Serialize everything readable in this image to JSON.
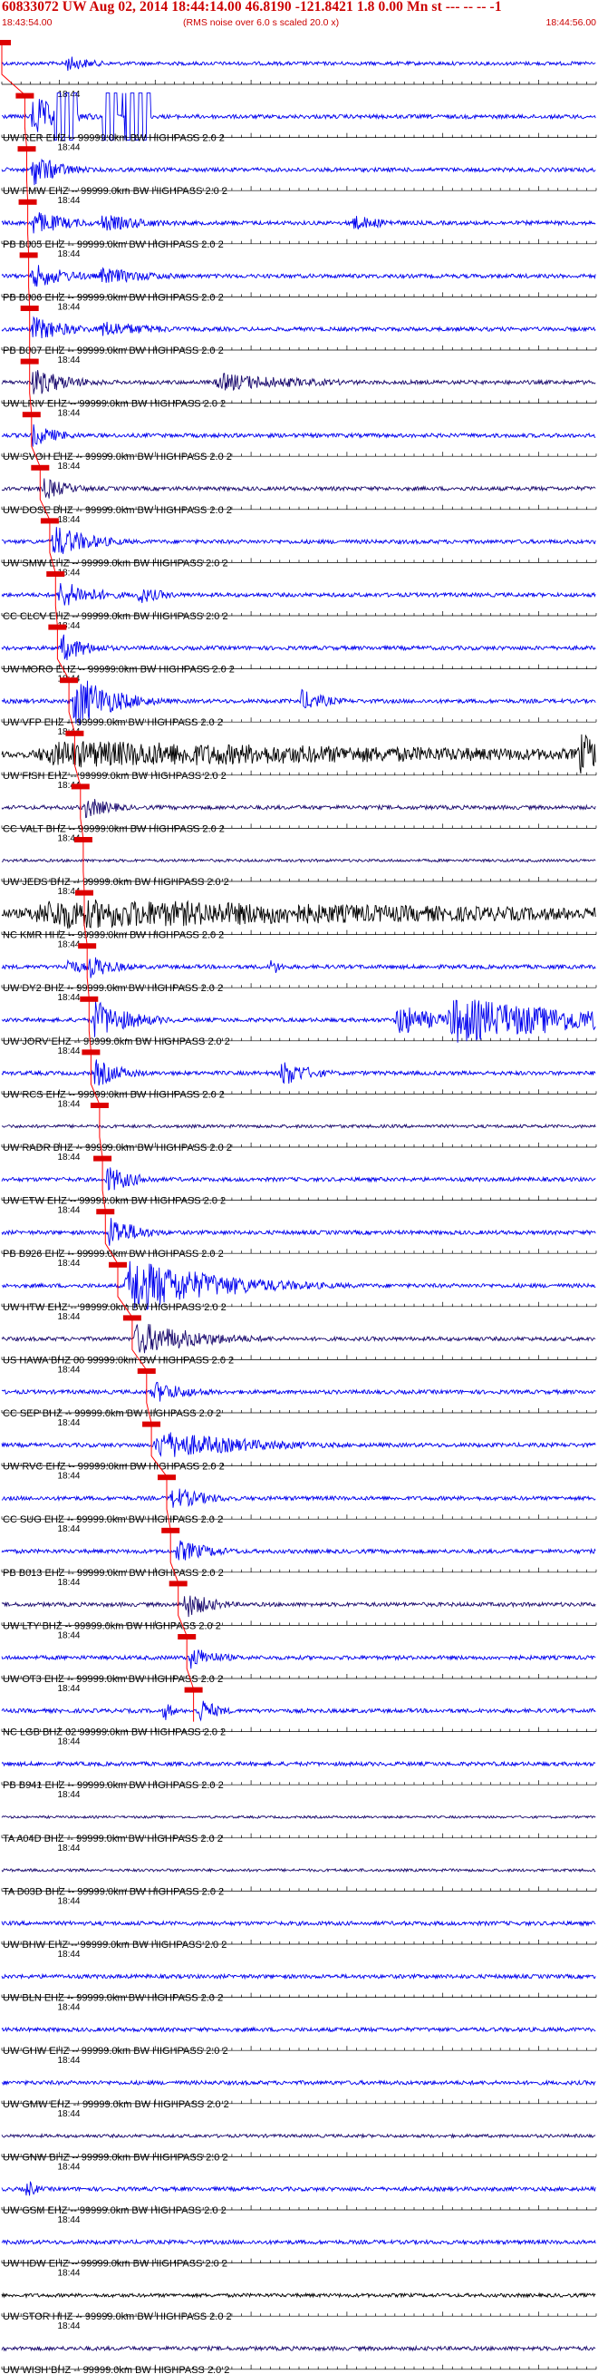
{
  "header": {
    "title": "60833072 UW Aug 02, 2014 18:44:14.00   46.8190 -121.8421  1.8 0.00 Mn st --- -- --  -1",
    "start_time": "18:43:54.00",
    "note": "(RMS noise over 6.0 s scaled 20.0 x)",
    "end_time": "18:44:56.00"
  },
  "colors": {
    "header_text": "#cc0000",
    "trace_blue": "#0000ee",
    "trace_navy": "#1a0a6e",
    "trace_black": "#000000",
    "pick_line": "#ff0000",
    "pick_box": "#dd0000",
    "label_text": "#000000",
    "tick": "#000000"
  },
  "chart_data": {
    "type": "seismogram",
    "time_start": "18:43:54.00",
    "time_end": "18:44:56.00",
    "tick_label": "18:44",
    "first_trace_name": "",
    "traces": [
      {
        "name": "",
        "color": "blue",
        "p_arrival_s": 0,
        "amp": 0.9,
        "bursts": [
          [
            6.5,
            3,
            1.6
          ]
        ]
      },
      {
        "name": "UW RER EHZ -- 99999.0km BW  HIGHPASS  2.0  2",
        "color": "blue",
        "p_arrival_s": 2.4,
        "amp": 1.0,
        "bursts": [
          [
            3,
            3,
            4
          ]
        ],
        "saturated": [
          [
            5.5,
            2.4
          ],
          [
            10.5,
            1.5
          ],
          [
            13,
            2.5
          ]
        ],
        "spikes": [
          11.8,
          12.6,
          12.9,
          13.8,
          14.2
        ]
      },
      {
        "name": "UW FMW EHZ -- 99999.0km BW  HIGHPASS  2.0  2",
        "color": "blue",
        "p_arrival_s": 2.6,
        "amp": 1.0,
        "bursts": [
          [
            3,
            3,
            3
          ]
        ]
      },
      {
        "name": "PB B005 EHZ -- 99999.0km BW  HIGHPASS  2.0  2",
        "color": "blue",
        "p_arrival_s": 2.7,
        "amp": 1.0,
        "bursts": [
          [
            3,
            4,
            2.2
          ],
          [
            10,
            6,
            1.5
          ],
          [
            36,
            4,
            1.5
          ]
        ]
      },
      {
        "name": "PB B006 EHZ -- 99999.0km BW  HIGHPASS  2.0  2",
        "color": "blue",
        "p_arrival_s": 2.8,
        "amp": 1.0,
        "bursts": [
          [
            3,
            4,
            2.2
          ],
          [
            10,
            6,
            1.5
          ]
        ]
      },
      {
        "name": "PB B007 EHZ -- 99999.0km BW  HIGHPASS  2.0  2",
        "color": "blue",
        "p_arrival_s": 2.9,
        "amp": 1.0,
        "bursts": [
          [
            3,
            4,
            2.2
          ],
          [
            10,
            6,
            1.5
          ]
        ]
      },
      {
        "name": "UW LRIV EHZ -- 99999.0km BW  HIGHPASS  2.0  2",
        "color": "navy",
        "p_arrival_s": 2.9,
        "amp": 1.0,
        "bursts": [
          [
            3,
            4,
            2.5
          ],
          [
            22,
            10,
            1.6
          ]
        ]
      },
      {
        "name": "UW SVOH EHZ -- 99999.0km BW  HIGHPASS  2.0  2",
        "color": "blue",
        "p_arrival_s": 3.1,
        "amp": 1.0,
        "bursts": [
          [
            3,
            3,
            2
          ]
        ]
      },
      {
        "name": "UW DOSE BHZ -- 99999.0km BW  HIGHPASS  2.0  2",
        "color": "navy",
        "p_arrival_s": 4.0,
        "amp": 1.0,
        "bursts": [
          [
            4.2,
            3,
            2
          ]
        ]
      },
      {
        "name": "UW SMW EHZ -- 99999.0km BW  HIGHPASS  2.0  2",
        "color": "blue",
        "p_arrival_s": 5.0,
        "amp": 1.0,
        "bursts": [
          [
            5.1,
            4,
            3
          ]
        ]
      },
      {
        "name": "CC CLCV EHZ -- 99999.0km BW  HIGHPASS  2.0  2",
        "color": "blue",
        "p_arrival_s": 5.6,
        "amp": 1.0,
        "bursts": [
          [
            5.8,
            4,
            2.5
          ],
          [
            14,
            3,
            1.6
          ]
        ]
      },
      {
        "name": "UW MORO EHZ -- 99999.0km BW  HIGHPASS  2.0  2",
        "color": "blue",
        "p_arrival_s": 5.8,
        "amp": 1.0,
        "bursts": [
          [
            6,
            3,
            2.5
          ]
        ]
      },
      {
        "name": "UW VFP EHZ -- 99999.0km BW  HIGHPASS  2.0  2",
        "color": "blue",
        "p_arrival_s": 7.0,
        "amp": 1.0,
        "bursts": [
          [
            7.3,
            4,
            5
          ],
          [
            31,
            3,
            2
          ]
        ]
      },
      {
        "name": "UW FISH EHZ -- 99999.0km BW  HIGHPASS  2.0  2",
        "color": "black",
        "p_arrival_s": 7.6,
        "amp": 1.6,
        "bursts": [
          [
            2,
            55,
            1.5
          ],
          [
            60,
            3,
            2.5
          ]
        ]
      },
      {
        "name": "CC VALT BHZ -- 99999.0km BW  HIGHPASS  2.0  2",
        "color": "navy",
        "p_arrival_s": 8.2,
        "amp": 1.0,
        "bursts": [
          [
            8.5,
            3,
            2
          ]
        ]
      },
      {
        "name": "UW JEDS BHZ -- 99999.0km BW  HIGHPASS  2.0  2",
        "color": "navy",
        "p_arrival_s": 8.5,
        "amp": 0.7,
        "bursts": []
      },
      {
        "name": "NC KMR HHZ -- 99999.0km BW  HIGHPASS  2.0  2",
        "color": "black",
        "p_arrival_s": 8.6,
        "amp": 2.2,
        "bursts": [
          [
            1,
            58,
            1.2
          ]
        ]
      },
      {
        "name": "UW DY2 BHZ -- 99999.0km BW  HIGHPASS  2.0  2",
        "color": "blue",
        "p_arrival_s": 8.9,
        "amp": 1.0,
        "bursts": [
          [
            9,
            3,
            2
          ],
          [
            6.5,
            2,
            1.8
          ],
          [
            28,
            1,
            1.8
          ]
        ]
      },
      {
        "name": "UW JORV EHZ -- 99999.0km BW  HIGHPASS  2.0  2",
        "color": "blue",
        "p_arrival_s": 9.1,
        "amp": 1.0,
        "bursts": [
          [
            9.3,
            4,
            3.5
          ],
          [
            41,
            4,
            3
          ],
          [
            46,
            16,
            4
          ]
        ]
      },
      {
        "name": "UW RCS EHZ -- 99999.0km BW  HIGHPASS  2.0  2",
        "color": "blue",
        "p_arrival_s": 9.3,
        "amp": 1.0,
        "bursts": [
          [
            9.5,
            3,
            2.5
          ],
          [
            29,
            3,
            2.5
          ]
        ]
      },
      {
        "name": "UW RADR BHZ -- 99999.0km BW  HIGHPASS  2.0  2",
        "color": "navy",
        "p_arrival_s": 10.2,
        "amp": 0.8,
        "bursts": []
      },
      {
        "name": "UW ETW EHZ -- 99999.0km BW  HIGHPASS  2.0  2",
        "color": "blue",
        "p_arrival_s": 10.5,
        "amp": 1.0,
        "bursts": [
          [
            10.8,
            3,
            2.5
          ]
        ]
      },
      {
        "name": "PB B926 EHZ -- 99999.0km BW  HIGHPASS  2.0  2",
        "color": "blue",
        "p_arrival_s": 10.8,
        "amp": 1.0,
        "bursts": [
          [
            11,
            3,
            3
          ]
        ]
      },
      {
        "name": "UW HTW EHZ -- 99999.0km BW  HIGHPASS  2.0  2",
        "color": "blue",
        "p_arrival_s": 12.1,
        "amp": 1.0,
        "bursts": [
          [
            12.7,
            9,
            5
          ]
        ]
      },
      {
        "name": "US HAWA BHZ 00 99999.0km BW  HIGHPASS  2.0  2",
        "color": "navy",
        "p_arrival_s": 13.6,
        "amp": 1.0,
        "bursts": [
          [
            13.6,
            7,
            3
          ]
        ]
      },
      {
        "name": "CC SEP BHZ -- 99999.0km BW  HIGHPASS  2.0  2",
        "color": "blue",
        "p_arrival_s": 15.1,
        "amp": 1.0,
        "bursts": [
          [
            15.5,
            4,
            2
          ]
        ]
      },
      {
        "name": "UW RVC EHZ -- 99999.0km BW  HIGHPASS  2.0  2",
        "color": "blue",
        "p_arrival_s": 15.6,
        "amp": 1.0,
        "bursts": [
          [
            15.7,
            10,
            2.5
          ],
          [
            19,
            5,
            2
          ]
        ]
      },
      {
        "name": "CC SUG EHZ -- 99999.0km BW  HIGHPASS  2.0  2",
        "color": "blue",
        "p_arrival_s": 17.2,
        "amp": 1.0,
        "bursts": [
          [
            17.5,
            4,
            2
          ]
        ]
      },
      {
        "name": "PB B013 EHZ -- 99999.0km BW  HIGHPASS  2.0  2",
        "color": "blue",
        "p_arrival_s": 17.6,
        "amp": 1.0,
        "bursts": [
          [
            18,
            4,
            2
          ]
        ]
      },
      {
        "name": "UW LTY BHZ -- 99999.0km BW  HIGHPASS  2.0  2",
        "color": "navy",
        "p_arrival_s": 18.4,
        "amp": 1.0,
        "bursts": [
          [
            18.8,
            3,
            2.5
          ]
        ]
      },
      {
        "name": "UW OT3 EHZ -- 99999.0km BW  HIGHPASS  2.0  2",
        "color": "blue",
        "p_arrival_s": 19.3,
        "amp": 1.0,
        "bursts": [
          [
            19.5,
            3,
            2
          ]
        ]
      },
      {
        "name": "NC LGB BHZ 02 99999.0km BW  HIGHPASS  2.0  2",
        "color": "blue",
        "p_arrival_s": 20.0,
        "amp": 1.0,
        "bursts": [
          [
            20.3,
            2,
            2.5
          ],
          [
            16.8,
            1,
            2
          ]
        ]
      },
      {
        "name": "PB B941 EHZ -- 99999.0km BW  HIGHPASS  2.0  2",
        "color": "blue",
        "p_arrival_s": null,
        "amp": 1.0,
        "bursts": []
      },
      {
        "name": "TA A04D BHZ -- 99999.0km BW  HIGHPASS  2.0  2",
        "color": "navy",
        "p_arrival_s": null,
        "amp": 0.6,
        "bursts": []
      },
      {
        "name": "TA D03D BHZ -- 99999.0km BW  HIGHPASS  2.0  2",
        "color": "navy",
        "p_arrival_s": null,
        "amp": 0.7,
        "bursts": []
      },
      {
        "name": "UW BHW EHZ -- 99999.0km BW  HIGHPASS  2.0  2",
        "color": "blue",
        "p_arrival_s": null,
        "amp": 1.0,
        "bursts": []
      },
      {
        "name": "UW BLN EHZ -- 99999.0km BW  HIGHPASS  2.0  2",
        "color": "blue",
        "p_arrival_s": null,
        "amp": 1.0,
        "bursts": []
      },
      {
        "name": "UW GHW EHZ -- 99999.0km BW  HIGHPASS  2.0  2",
        "color": "blue",
        "p_arrival_s": null,
        "amp": 1.0,
        "bursts": []
      },
      {
        "name": "UW GMW EHZ -- 99999.0km BW  HIGHPASS  2.0  2",
        "color": "blue",
        "p_arrival_s": null,
        "amp": 1.0,
        "bursts": []
      },
      {
        "name": "UW GNW BHZ -- 99999.0km BW  HIGHPASS  2.0  2",
        "color": "navy",
        "p_arrival_s": null,
        "amp": 0.8,
        "bursts": []
      },
      {
        "name": "UW GSM EHZ -- 99999.0km BW  HIGHPASS  2.0  2",
        "color": "blue",
        "p_arrival_s": null,
        "amp": 1.0,
        "bursts": [
          [
            2.5,
            1,
            2
          ]
        ]
      },
      {
        "name": "UW HDW EHZ -- 99999.0km BW  HIGHPASS  2.0  2",
        "color": "blue",
        "p_arrival_s": null,
        "amp": 1.0,
        "bursts": []
      },
      {
        "name": "UW STOR HHZ -- 99999.0km BW  HIGHPASS  2.0  2",
        "color": "black",
        "p_arrival_s": null,
        "amp": 0.9,
        "bursts": []
      },
      {
        "name": "UW WISH BHZ -- 99999.0km BW  HIGHPASS  2.0  2",
        "color": "navy",
        "p_arrival_s": null,
        "amp": 1.0,
        "bursts": []
      }
    ]
  }
}
